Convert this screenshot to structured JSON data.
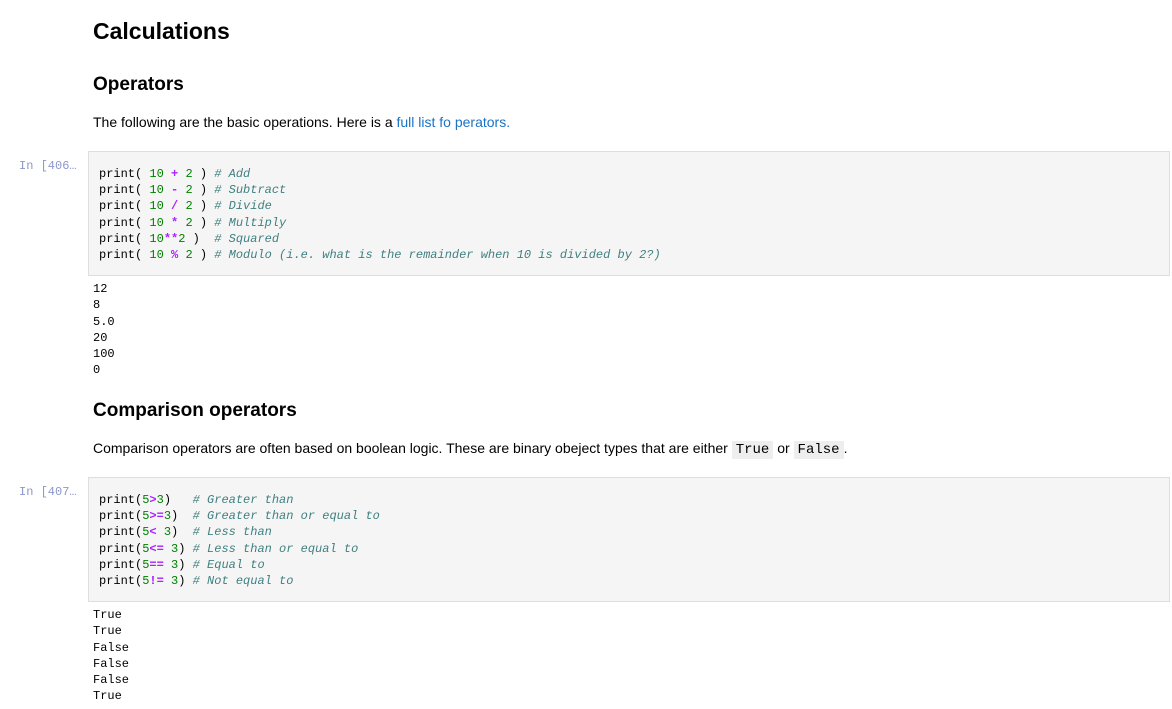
{
  "title": "Calculations",
  "sections": {
    "operators": {
      "heading": "Operators",
      "text_before": "The following are the basic operations. Here is a ",
      "link_text": "full list fo perators.",
      "prompt": "In [406…",
      "code_lines": [
        [
          {
            "t": "text",
            "v": "print( "
          },
          {
            "t": "num",
            "v": "10"
          },
          {
            "t": "text",
            "v": " "
          },
          {
            "t": "op",
            "v": "+"
          },
          {
            "t": "text",
            "v": " "
          },
          {
            "t": "num",
            "v": "2"
          },
          {
            "t": "text",
            "v": " ) "
          },
          {
            "t": "comment",
            "v": "# Add"
          }
        ],
        [
          {
            "t": "text",
            "v": "print( "
          },
          {
            "t": "num",
            "v": "10"
          },
          {
            "t": "text",
            "v": " "
          },
          {
            "t": "op",
            "v": "-"
          },
          {
            "t": "text",
            "v": " "
          },
          {
            "t": "num",
            "v": "2"
          },
          {
            "t": "text",
            "v": " ) "
          },
          {
            "t": "comment",
            "v": "# Subtract"
          }
        ],
        [
          {
            "t": "text",
            "v": "print( "
          },
          {
            "t": "num",
            "v": "10"
          },
          {
            "t": "text",
            "v": " "
          },
          {
            "t": "op",
            "v": "/"
          },
          {
            "t": "text",
            "v": " "
          },
          {
            "t": "num",
            "v": "2"
          },
          {
            "t": "text",
            "v": " ) "
          },
          {
            "t": "comment",
            "v": "# Divide"
          }
        ],
        [
          {
            "t": "text",
            "v": "print( "
          },
          {
            "t": "num",
            "v": "10"
          },
          {
            "t": "text",
            "v": " "
          },
          {
            "t": "op",
            "v": "*"
          },
          {
            "t": "text",
            "v": " "
          },
          {
            "t": "num",
            "v": "2"
          },
          {
            "t": "text",
            "v": " ) "
          },
          {
            "t": "comment",
            "v": "# Multiply"
          }
        ],
        [
          {
            "t": "text",
            "v": "print( "
          },
          {
            "t": "num",
            "v": "10"
          },
          {
            "t": "op",
            "v": "**"
          },
          {
            "t": "num",
            "v": "2"
          },
          {
            "t": "text",
            "v": " )  "
          },
          {
            "t": "comment",
            "v": "# Squared"
          }
        ],
        [
          {
            "t": "text",
            "v": "print( "
          },
          {
            "t": "num",
            "v": "10"
          },
          {
            "t": "text",
            "v": " "
          },
          {
            "t": "op",
            "v": "%"
          },
          {
            "t": "text",
            "v": " "
          },
          {
            "t": "num",
            "v": "2"
          },
          {
            "t": "text",
            "v": " ) "
          },
          {
            "t": "comment",
            "v": "# Modulo (i.e. what is the remainder when 10 is divided by 2?)"
          }
        ]
      ],
      "output_lines": [
        "12",
        "8",
        "5.0",
        "20",
        "100",
        "0"
      ]
    },
    "comparison": {
      "heading": "Comparison operators",
      "text_before": "Comparison operators are often based on boolean logic. These are binary obeject types that are either ",
      "code_true": "True",
      "text_or": " or ",
      "code_false": "False",
      "text_after": ".",
      "prompt": "In [407…",
      "code_lines": [
        [
          {
            "t": "text",
            "v": "print("
          },
          {
            "t": "num",
            "v": "5"
          },
          {
            "t": "op",
            "v": ">"
          },
          {
            "t": "num",
            "v": "3"
          },
          {
            "t": "text",
            "v": ")   "
          },
          {
            "t": "comment",
            "v": "# Greater than"
          }
        ],
        [
          {
            "t": "text",
            "v": "print("
          },
          {
            "t": "num",
            "v": "5"
          },
          {
            "t": "op",
            "v": ">="
          },
          {
            "t": "num",
            "v": "3"
          },
          {
            "t": "text",
            "v": ")  "
          },
          {
            "t": "comment",
            "v": "# Greater than or equal to"
          }
        ],
        [
          {
            "t": "text",
            "v": "print("
          },
          {
            "t": "num",
            "v": "5"
          },
          {
            "t": "op",
            "v": "<"
          },
          {
            "t": "text",
            "v": " "
          },
          {
            "t": "num",
            "v": "3"
          },
          {
            "t": "text",
            "v": ")  "
          },
          {
            "t": "comment",
            "v": "# Less than"
          }
        ],
        [
          {
            "t": "text",
            "v": "print("
          },
          {
            "t": "num",
            "v": "5"
          },
          {
            "t": "op",
            "v": "<="
          },
          {
            "t": "text",
            "v": " "
          },
          {
            "t": "num",
            "v": "3"
          },
          {
            "t": "text",
            "v": ") "
          },
          {
            "t": "comment",
            "v": "# Less than or equal to"
          }
        ],
        [
          {
            "t": "text",
            "v": "print("
          },
          {
            "t": "num",
            "v": "5"
          },
          {
            "t": "op",
            "v": "=="
          },
          {
            "t": "text",
            "v": " "
          },
          {
            "t": "num",
            "v": "3"
          },
          {
            "t": "text",
            "v": ") "
          },
          {
            "t": "comment",
            "v": "# Equal to"
          }
        ],
        [
          {
            "t": "text",
            "v": "print("
          },
          {
            "t": "num",
            "v": "5"
          },
          {
            "t": "op",
            "v": "!="
          },
          {
            "t": "text",
            "v": " "
          },
          {
            "t": "num",
            "v": "3"
          },
          {
            "t": "text",
            "v": ") "
          },
          {
            "t": "comment",
            "v": "# Not equal to"
          }
        ]
      ],
      "output_lines": [
        "True",
        "True",
        "False",
        "False",
        "False",
        "True"
      ]
    }
  },
  "colors": {
    "number": "#008000",
    "operator": "#aa22ff",
    "comment": "#408080",
    "link": "#1a73c4",
    "cell_background": "#f5f5f5"
  }
}
